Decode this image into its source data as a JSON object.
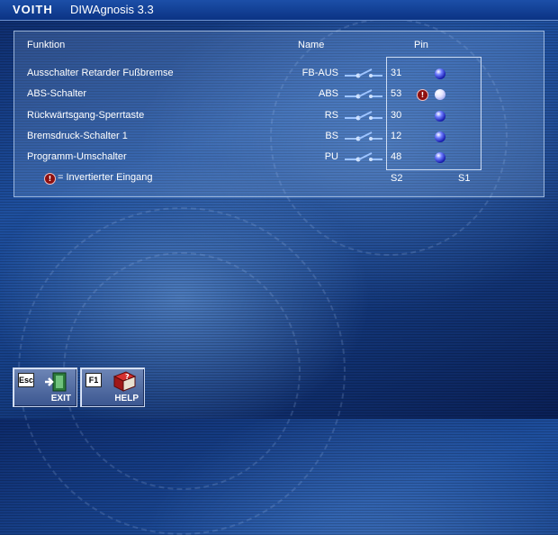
{
  "window": {
    "brand": "VOITH",
    "title": "DIWAgnosis 3.3"
  },
  "panel": {
    "headers": {
      "function": "Funktion",
      "name": "Name",
      "pin": "Pin"
    },
    "rows": [
      {
        "function": "Ausschalter Retarder Fußbremse",
        "name": "FB-AUS",
        "pin": "31",
        "inverted": false,
        "state": "off"
      },
      {
        "function": "ABS-Schalter",
        "name": "ABS",
        "pin": "53",
        "inverted": true,
        "state": "on"
      },
      {
        "function": "Rückwärtsgang-Sperrtaste",
        "name": "RS",
        "pin": "30",
        "inverted": false,
        "state": "off"
      },
      {
        "function": "Bremsdruck-Schalter 1",
        "name": "BS",
        "pin": "12",
        "inverted": false,
        "state": "off"
      },
      {
        "function": "Programm-Umschalter",
        "name": "PU",
        "pin": "48",
        "inverted": false,
        "state": "off"
      }
    ],
    "legend": "= Invertierter Eingang",
    "inverted_marker": "!",
    "s2_label": "S2",
    "s1_label": "S1"
  },
  "buttons": {
    "exit": {
      "key": "Esc",
      "label": "EXIT"
    },
    "help": {
      "key": "F1",
      "label": "HELP"
    }
  },
  "colors": {
    "inverted_marker": "#8e1010",
    "indicator": "#1a1fb0"
  }
}
